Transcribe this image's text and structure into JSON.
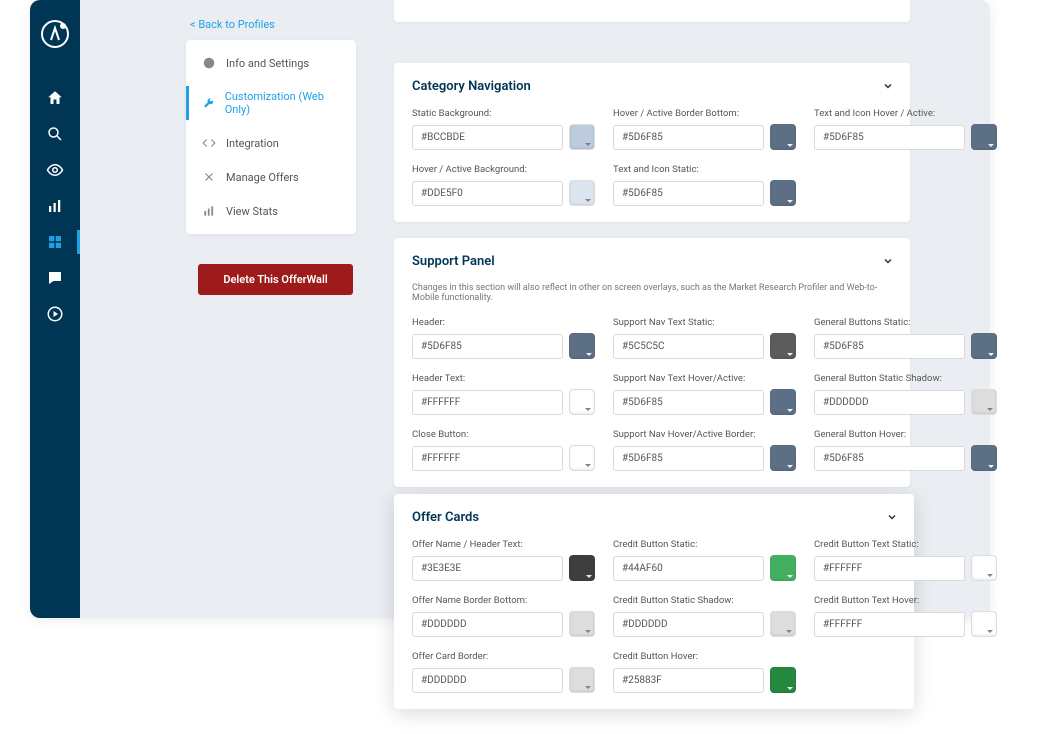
{
  "nav": {
    "back": "< Back to Profiles",
    "items": [
      {
        "label": "Info and Settings"
      },
      {
        "label": "Customization  (Web Only)"
      },
      {
        "label": "Integration"
      },
      {
        "label": "Manage Offers"
      },
      {
        "label": "View Stats"
      }
    ],
    "delete": "Delete This OfferWall"
  },
  "panels": {
    "cat": {
      "title": "Category Navigation",
      "fields": [
        {
          "l": "Static Background:",
          "v": "#BCCBDE",
          "c": "#BCCBDE"
        },
        {
          "l": "Hover / Active Border Bottom:",
          "v": "#5D6F85",
          "c": "#5D6F85"
        },
        {
          "l": "Text and Icon Hover / Active:",
          "v": "#5D6F85",
          "c": "#5D6F85"
        },
        {
          "l": "Hover / Active Background:",
          "v": "#DDE5F0",
          "c": "#DDE5F0"
        },
        {
          "l": "Text and Icon Static:",
          "v": "#5D6F85",
          "c": "#5D6F85"
        }
      ]
    },
    "support": {
      "title": "Support Panel",
      "desc": "Changes in this section will also reflect in other on screen overlays, such as the Market Research Profiler and Web-to-Mobile functionality.",
      "fields": [
        {
          "l": "Header:",
          "v": "#5D6F85",
          "c": "#5D6F85"
        },
        {
          "l": "Support Nav Text Static:",
          "v": "#5C5C5C",
          "c": "#5C5C5C"
        },
        {
          "l": "General Buttons Static:",
          "v": "#5D6F85",
          "c": "#5D6F85"
        },
        {
          "l": "Header Text:",
          "v": "#FFFFFF",
          "c": "#FFFFFF"
        },
        {
          "l": "Support Nav Text Hover/Active:",
          "v": "#5D6F85",
          "c": "#5D6F85"
        },
        {
          "l": "General Button Static Shadow:",
          "v": "#DDDDDD",
          "c": "#DDDDDD"
        },
        {
          "l": "Close Button:",
          "v": "#FFFFFF",
          "c": "#FFFFFF"
        },
        {
          "l": "Support Nav Hover/Active Border:",
          "v": "#5D6F85",
          "c": "#5D6F85"
        },
        {
          "l": "General Button Hover:",
          "v": "#5D6F85",
          "c": "#5D6F85"
        }
      ]
    },
    "offer": {
      "title": "Offer Cards",
      "fields": [
        {
          "l": "Offer Name / Header Text:",
          "v": "#3E3E3E",
          "c": "#3E3E3E"
        },
        {
          "l": "Credit Button Static:",
          "v": "#44AF60",
          "c": "#44AF60"
        },
        {
          "l": "Credit Button Text Static:",
          "v": "#FFFFFF",
          "c": "#FFFFFF"
        },
        {
          "l": "Offer Name Border Bottom:",
          "v": "#DDDDDD",
          "c": "#DDDDDD"
        },
        {
          "l": "Credit Button Static Shadow:",
          "v": "#DDDDDD",
          "c": "#DDDDDD"
        },
        {
          "l": "Credit Button Text Hover:",
          "v": "#FFFFFF",
          "c": "#FFFFFF"
        },
        {
          "l": "Offer Card Border:",
          "v": "#DDDDDD",
          "c": "#DDDDDD"
        },
        {
          "l": "Credit Button Hover:",
          "v": "#25883F",
          "c": "#25883F"
        }
      ]
    }
  }
}
